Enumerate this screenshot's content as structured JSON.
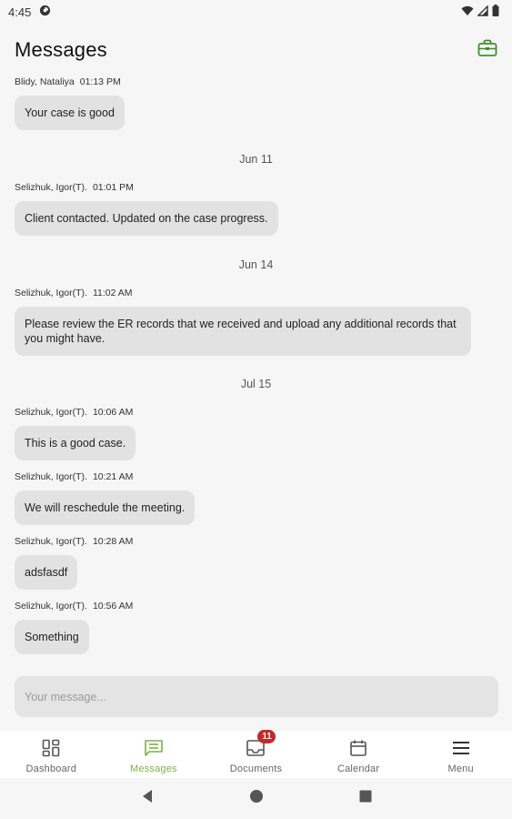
{
  "status_bar": {
    "time": "4:45"
  },
  "header": {
    "title": "Messages",
    "case_icon": "briefcase-icon"
  },
  "messages": [
    {
      "author": "Blidy, Nataliya",
      "time": "01:13 PM",
      "text": "Your case is good"
    },
    {
      "date": "Jun 11"
    },
    {
      "author": "Selizhuk, Igor(T).",
      "time": "01:01 PM",
      "text": "Client contacted. Updated on the case progress."
    },
    {
      "date": "Jun 14"
    },
    {
      "author": "Selizhuk, Igor(T).",
      "time": "11:02 AM",
      "text": "Please review the ER records that we received and upload any additional records that you might have."
    },
    {
      "date": "Jul 15"
    },
    {
      "author": "Selizhuk, Igor(T).",
      "time": "10:06 AM",
      "text": "This is a good case."
    },
    {
      "author": "Selizhuk, Igor(T).",
      "time": "10:21 AM",
      "text": "We will reschedule the meeting."
    },
    {
      "author": "Selizhuk, Igor(T).",
      "time": "10:28 AM",
      "text": "adsfasdf"
    },
    {
      "author": "Selizhuk, Igor(T).",
      "time": "10:56 AM",
      "text": "Something"
    }
  ],
  "composer": {
    "placeholder": "Your message...",
    "value": ""
  },
  "bottom_nav": {
    "items": [
      {
        "label": "Dashboard",
        "icon": "dashboard-icon",
        "active": false
      },
      {
        "label": "Messages",
        "icon": "chat-icon",
        "active": true
      },
      {
        "label": "Documents",
        "icon": "inbox-icon",
        "active": false,
        "badge": "11"
      },
      {
        "label": "Calendar",
        "icon": "calendar-icon",
        "active": false
      },
      {
        "label": "Menu",
        "icon": "hamburger-icon",
        "active": false
      }
    ]
  },
  "colors": {
    "accent": "#7cb342",
    "badge": "#c62828",
    "bubble": "#e2e2e2",
    "background": "#f6f6f6"
  }
}
